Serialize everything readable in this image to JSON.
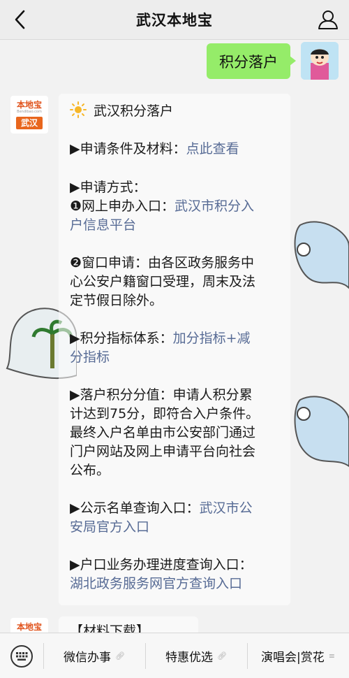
{
  "header": {
    "title": "武汉本地宝"
  },
  "user_message": "积分落户",
  "bot": {
    "logo_top": "本地宝",
    "logo_sub": "Bendibao.com",
    "logo_city": "武汉",
    "heading_icon": "sun-icon",
    "heading": "武汉积分落户",
    "lines": {
      "l1_prefix": "▶申请条件及材料：",
      "l1_link": "点此查看",
      "l2": "▶申请方式：",
      "l3_prefix": "❶网上申办入口：",
      "l3_link_a": "武汉市积分入",
      "l3_link_b": "户信息平台",
      "l4_a": "❷窗口申请：由各区政务服务中",
      "l4_b": "心公安户籍窗口受理，周末及法",
      "l4_c": "定节假日除外。",
      "l5_prefix": "▶积分指标体系：",
      "l5_link_a": "加分指标+减",
      "l5_link_b": "分指标",
      "l6_a": "▶落户积分分值：申请人积分累",
      "l6_b": "计达到75分，即符合入户条件。",
      "l6_c": "最终入户名单由市公安部门通过",
      "l6_d": "门户网站及网上申请平台向社会",
      "l6_e": "公布。",
      "l7_prefix": "▶公示名单查询入口：",
      "l7_link_a": "武汉市公",
      "l7_link_b": "安局官方入口",
      "l8": "▶户口业务办理进度查询入口：",
      "l8_link": "湖北政务服务网官方查询入口"
    },
    "next_message": "【材料下载】"
  },
  "bottom_menu": {
    "items": [
      "微信办事",
      "特惠优选",
      "演唱会|赏花"
    ],
    "keyboard_icon": "keyboard-icon",
    "link_icon": "link-icon",
    "menu_icon": "menu-lines-icon"
  },
  "colors": {
    "link": "#576b95",
    "user_bubble": "#95ec69",
    "brand": "#e8661d"
  }
}
